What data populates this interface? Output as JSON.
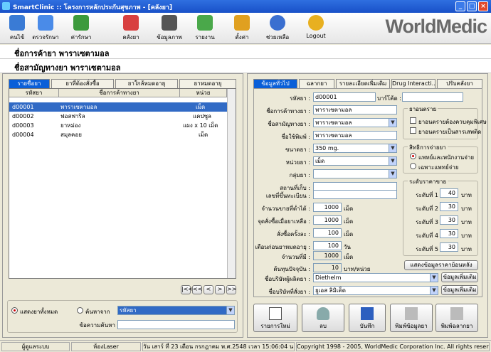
{
  "window": {
    "title": "SmartClinic :: โครงการหลักประกันสุขภาพ - [คลังยา]"
  },
  "toolbar": {
    "items": [
      {
        "label": "คนไข้"
      },
      {
        "label": "ตรวจรักษา"
      },
      {
        "label": "ค่ารักษา"
      },
      {
        "label": "คลังยา"
      },
      {
        "label": "ข้อมูลภาพ"
      },
      {
        "label": "รายงาน"
      },
      {
        "label": "ตั้งค่า"
      },
      {
        "label": "ช่วยเหลือ"
      },
      {
        "label": "Logout"
      }
    ],
    "brand": "WorldMedic"
  },
  "header": {
    "trade_name_line": "ชื่อการค้ายา พาราเซตามอล",
    "generic_name_line": "ชื่อสามัญทางยา พาราเซตามอล"
  },
  "left": {
    "tabs": [
      "รายชื่อยา",
      "ยาที่ต้องสั่งซื้อ",
      "ยาใกล้หมดอายุ",
      "ยาหมดอายุ"
    ],
    "columns": [
      "รหัสยา",
      "ชื่อการค้าทางยา",
      "หน่วย"
    ],
    "rows": [
      {
        "code": "d00001",
        "name": "พาราเซตามอล",
        "unit": "เม็ด"
      },
      {
        "code": "d00002",
        "name": "ฟอสฟาริล",
        "unit": "แคปซูล"
      },
      {
        "code": "d00003",
        "name": "ยาหม่อง",
        "unit": "แผง x 10 เม็ด"
      },
      {
        "code": "d00004",
        "name": "สมุลคอย",
        "unit": "เม็ด"
      }
    ],
    "pager": [
      "|<<",
      "<<",
      "<",
      ">",
      ">>"
    ],
    "show_all": "แสดงยาทั้งหมด",
    "search_by": "ค้นหาจาก",
    "search_field": "รหัสยา",
    "search_text_label": "ข้อความค้นหา"
  },
  "right": {
    "tabs": [
      "ข้อมูลทั่วไป",
      "ฉลากยา",
      "รายละเอียดเพิ่มเติม",
      "Drug Interacti...",
      "ปรับคลังยา"
    ],
    "fields": {
      "code_label": "รหัสยา :",
      "code": "d00001",
      "barcode_label": "บาร์โค้ด :",
      "barcode": "",
      "trade_label": "ชื่อการค้าทางยา :",
      "trade": "พาราเซตามอล",
      "generic_label": "ชื่อสามัญทางยา :",
      "generic": "พาราเซตามอล",
      "print_label": "ชื่อใช้พิมพ์ :",
      "print": "พาราเซตามอล",
      "dose_label": "ขนาดยา :",
      "dose": "350 mg.",
      "unit_label": "หน่วยยา :",
      "unit": "เม็ด",
      "group_label": "กลุ่มยา :",
      "group": "",
      "store_label": "สถานที่เก็บ :",
      "store": "",
      "reg_label": "เลขที่ขึ้นทะเบียน :",
      "reg": "",
      "min_label": "จำนวนขายที่ต่ำได้ :",
      "min": "1000",
      "min_unit": "เม็ด",
      "reorder_label": "จุดสั่งซื้อเมื่อยาเหลือ :",
      "reorder": "1000",
      "reorder_unit": "เม็ด",
      "order_label": "สั่งซื้อครั้งละ :",
      "order": "100",
      "order_unit": "เม็ด",
      "warn_label": "เตือนก่อนยาหมดอายุ :",
      "warn": "100",
      "warn_unit": "วัน",
      "qty_label": "จำนวนที่มี :",
      "qty": "1000",
      "qty_unit": "เม็ด",
      "cost_label": "ต้นทุนปัจจุบัน :",
      "cost": "10",
      "cost_unit": "บาท/หน่วย",
      "supplier_label": "ชื่อบริษัทผู้ผลิตยา :",
      "supplier": "Diethelm",
      "supplier_btn": "ข้อมูลเพิ่มเติม",
      "vendor_label": "ชื่อบริษัทที่สั่งยา :",
      "vendor": "ยูเอส ลิมิเต็ด",
      "vendor_btn": "ข้อมูลเพิ่มเติม"
    },
    "narcotic": {
      "title": "ยาอนตราย",
      "opt1": "ยาอนตรายต้องควบคุมพิเศษ",
      "opt2": "ยาอนตรายเป็นสารเสพติด"
    },
    "dispense": {
      "title": "สิทธิการจ่ายยา",
      "opt1": "แพทย์และพนักงานจ่าย",
      "opt2": "เฉพาะแพทย์จ่าย"
    },
    "price": {
      "title": "ระดับราคาขาย",
      "unit": "บาท",
      "levels": [
        {
          "label": "ระดับที่ 1",
          "value": "40"
        },
        {
          "label": "ระดับที่ 2",
          "value": "30"
        },
        {
          "label": "ระดับที่ 3",
          "value": "30"
        },
        {
          "label": "ระดับที่ 4",
          "value": "30"
        },
        {
          "label": "ระดับที่ 5",
          "value": "30"
        }
      ]
    },
    "history_btn": "แสดงข้อมูลราคาย้อนหลัง",
    "actions": [
      "รายการใหม่",
      "ลบ",
      "บันทึก",
      "พิมพ์ข้อมูลยา",
      "พิมพ์ฉลากยา"
    ]
  },
  "status": [
    "ผู้ดูแลระบบ",
    "ห้องLaser",
    "วัน เสาร์ ที่ 23 เดือน กรกฎาคม พ.ศ.2548 เวลา 15:06:04 น.",
    "Copyright 1998 - 2005, WorldMedic Corporation Inc. All rights reserved."
  ],
  "colors": {
    "selected": "#316ac5",
    "titlebar": "#1850c8"
  }
}
